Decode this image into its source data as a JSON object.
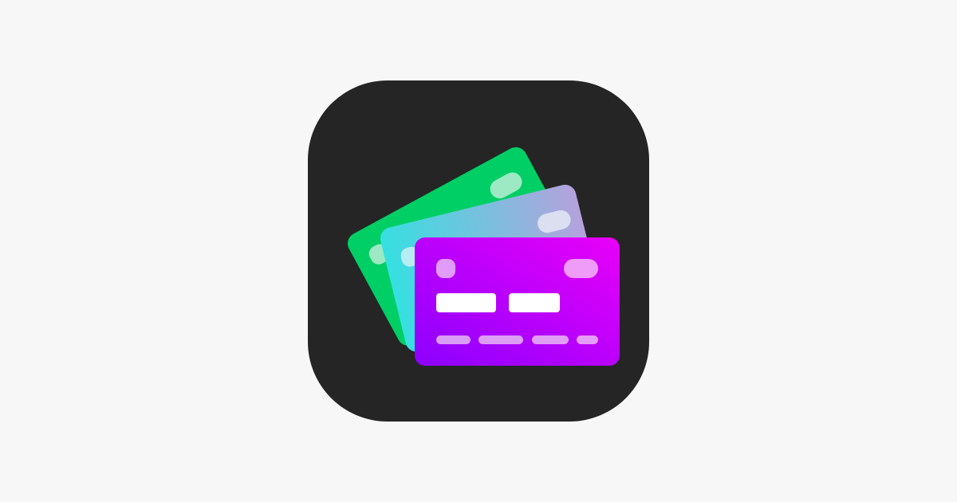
{
  "app_icon": {
    "icon_name": "credit-cards-icon",
    "background_color": "#252525",
    "page_background": "#f7f7f7",
    "cards": {
      "back": {
        "color": "#00cf65",
        "accent": "#9de9c4"
      },
      "middle": {
        "gradient": [
          "#35e0e0",
          "#b5a2dc"
        ],
        "accent": "#dbdff0"
      },
      "front": {
        "gradient": [
          "#8c00ff",
          "#e800f8"
        ],
        "chip": "#e09cf8",
        "bars": "#ffffff",
        "number_dashes": "#df9cf4"
      }
    }
  }
}
